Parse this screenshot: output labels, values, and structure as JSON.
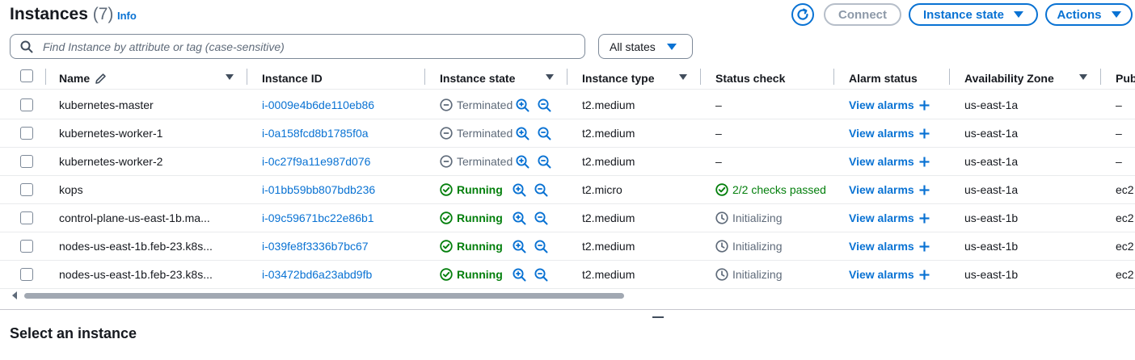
{
  "header": {
    "title": "Instances",
    "count": "(7)",
    "info_label": "Info",
    "connect_label": "Connect",
    "instance_state_label": "Instance state",
    "actions_label": "Actions"
  },
  "search": {
    "placeholder": "Find Instance by attribute or tag (case-sensitive)",
    "value": ""
  },
  "filter": {
    "selected": "All states"
  },
  "columns": {
    "name": "Name",
    "instance_id": "Instance ID",
    "instance_state": "Instance state",
    "instance_type": "Instance type",
    "status_check": "Status check",
    "alarm_status": "Alarm status",
    "availability_zone": "Availability Zone",
    "public": "Pub"
  },
  "rows": [
    {
      "name": "kubernetes-master",
      "id": "i-0009e4b6de110eb86",
      "state": "Terminated",
      "type": "t2.medium",
      "status": "–",
      "alarm": "View alarms",
      "zone": "us-east-1a",
      "public": "–"
    },
    {
      "name": "kubernetes-worker-1",
      "id": "i-0a158fcd8b1785f0a",
      "state": "Terminated",
      "type": "t2.medium",
      "status": "–",
      "alarm": "View alarms",
      "zone": "us-east-1a",
      "public": "–"
    },
    {
      "name": "kubernetes-worker-2",
      "id": "i-0c27f9a11e987d076",
      "state": "Terminated",
      "type": "t2.medium",
      "status": "–",
      "alarm": "View alarms",
      "zone": "us-east-1a",
      "public": "–"
    },
    {
      "name": "kops",
      "id": "i-01bb59bb807bdb236",
      "state": "Running",
      "type": "t2.micro",
      "status": "2/2 checks passed",
      "alarm": "View alarms",
      "zone": "us-east-1a",
      "public": "ec2"
    },
    {
      "name": "control-plane-us-east-1b.ma...",
      "id": "i-09c59671bc22e86b1",
      "state": "Running",
      "type": "t2.medium",
      "status": "Initializing",
      "alarm": "View alarms",
      "zone": "us-east-1b",
      "public": "ec2"
    },
    {
      "name": "nodes-us-east-1b.feb-23.k8s...",
      "id": "i-039fe8f3336b7bc67",
      "state": "Running",
      "type": "t2.medium",
      "status": "Initializing",
      "alarm": "View alarms",
      "zone": "us-east-1b",
      "public": "ec2"
    },
    {
      "name": "nodes-us-east-1b.feb-23.k8s...",
      "id": "i-03472bd6a23abd9fb",
      "state": "Running",
      "type": "t2.medium",
      "status": "Initializing",
      "alarm": "View alarms",
      "zone": "us-east-1b",
      "public": "ec2"
    }
  ],
  "details": {
    "heading": "Select an instance"
  },
  "colors": {
    "link": "#0972d3",
    "running": "#037f0c",
    "terminated": "#5f6b7a",
    "border": "#7d8998"
  }
}
